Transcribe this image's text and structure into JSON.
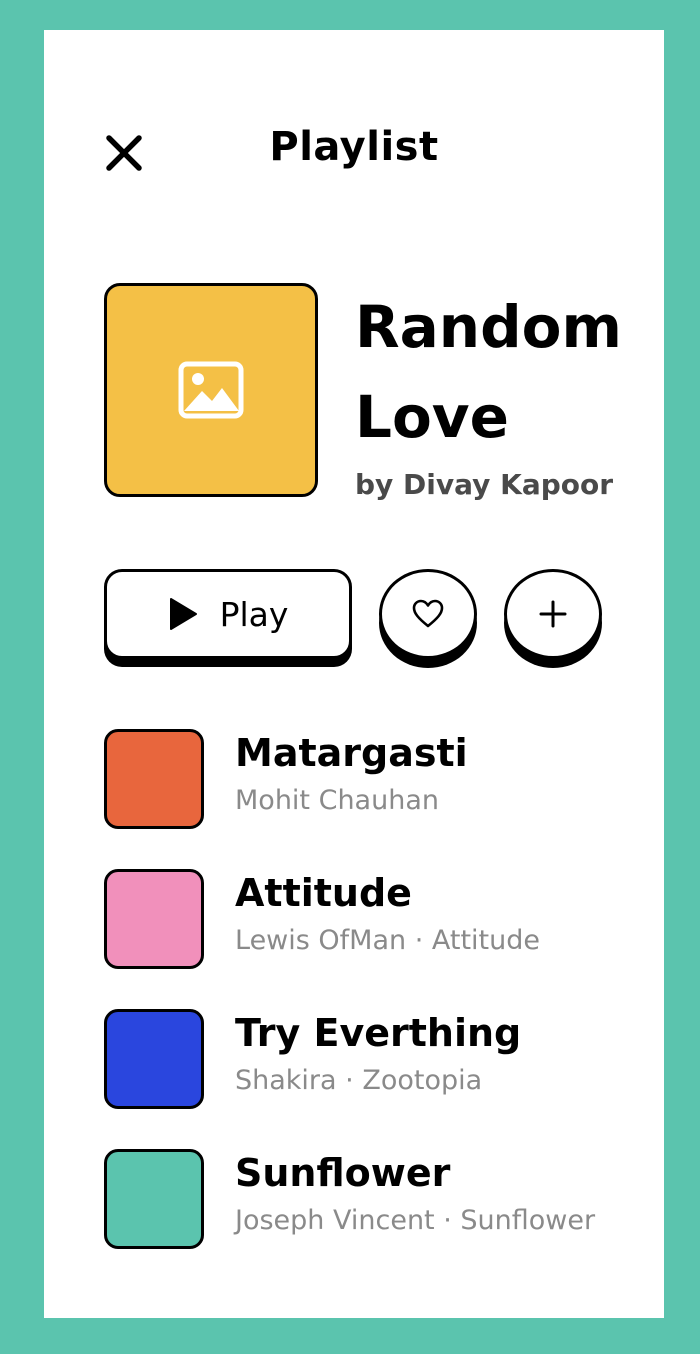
{
  "header": {
    "title": "Playlist",
    "close_icon": "close-icon"
  },
  "playlist": {
    "name": "Random Love",
    "author": "by Divay Kapoor",
    "cover_color": "#f4c046",
    "cover_icon": "image-icon"
  },
  "actions": {
    "play_label": "Play",
    "play_icon": "play-icon",
    "like_icon": "heart-icon",
    "add_icon": "plus-icon"
  },
  "tracks": [
    {
      "title": "Matargasti",
      "subtitle": "Mohit Chauhan",
      "color": "#e8663d"
    },
    {
      "title": "Attitude",
      "subtitle": "Lewis OfMan · Attitude",
      "color": "#f190bb"
    },
    {
      "title": "Try Everthing",
      "subtitle": "Shakira · Zootopia",
      "color": "#2a46de"
    },
    {
      "title": "Sunflower",
      "subtitle": "Joseph Vincent · Sunflower",
      "color": "#5bc4ae"
    }
  ],
  "colors": {
    "background": "#5bc4ae",
    "card": "#ffffff",
    "accent_yellow": "#f4c046"
  }
}
